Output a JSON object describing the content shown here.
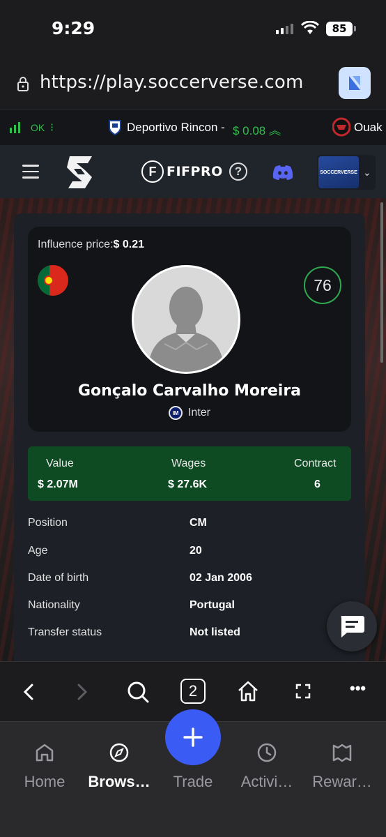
{
  "status_bar": {
    "time": "9:29",
    "battery": "85"
  },
  "browser": {
    "url": "https://play.soccerverse.com"
  },
  "ticker": {
    "left_status": "OK",
    "club": "Deportivo Rincon -",
    "price": "$ 0.08",
    "next_club": "Ouak"
  },
  "header": {
    "partner_label": "FIFPRO",
    "club_crest_text": "SOCCERVERSE"
  },
  "player": {
    "influence_label": "Influence price:",
    "influence_value": "$ 0.21",
    "rating": "76",
    "name": "Gonçalo Carvalho Moreira",
    "club": "Inter",
    "nationality_flag": "portugal-flag"
  },
  "stats": {
    "value_label": "Value",
    "value": "$ 2.07M",
    "wages_label": "Wages",
    "wages": "$ 27.6K",
    "contract_label": "Contract",
    "contract": "6"
  },
  "details": [
    {
      "label": "Position",
      "value": "CM"
    },
    {
      "label": "Age",
      "value": "20"
    },
    {
      "label": "Date of birth",
      "value": "02 Jan 2006"
    },
    {
      "label": "Nationality",
      "value": "Portugal"
    },
    {
      "label": "Transfer status",
      "value": "Not listed"
    }
  ],
  "browser_toolbar": {
    "tabs_count": "2"
  },
  "tab_bar": {
    "items": [
      {
        "label": "Home"
      },
      {
        "label": "Brows…"
      },
      {
        "label": "Trade"
      },
      {
        "label": "Activi…"
      },
      {
        "label": "Rewar…"
      }
    ]
  },
  "colors": {
    "accent_green": "#2fbf4a",
    "trade_blue": "#3a5cf5",
    "stats_bg": "#0e4a22"
  }
}
